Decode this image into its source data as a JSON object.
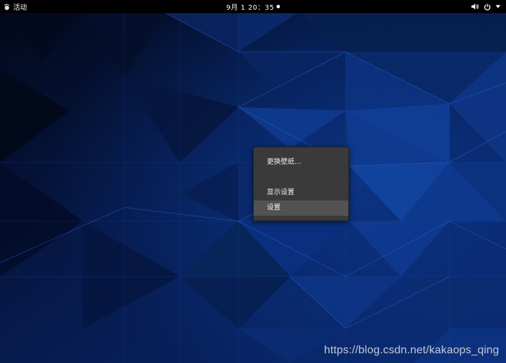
{
  "topbar": {
    "activities_label": "活动",
    "clock": "9月 1  20：35",
    "tray_icons": [
      "volume-icon",
      "power-icon",
      "menu-arrow-icon"
    ]
  },
  "context_menu": {
    "items": [
      {
        "label": "更换壁纸…"
      },
      {
        "label": "显示设置"
      },
      {
        "label": "设置",
        "highlighted": true
      }
    ]
  },
  "watermark": "https://blog.csdn.net/kakaops_qing",
  "colors": {
    "topbar_bg": "#000000",
    "menu_bg": "#3a3a3a",
    "menu_highlight": "#525252",
    "wallpaper_base": "#071a40",
    "wallpaper_accent": "#0d3a8a"
  }
}
